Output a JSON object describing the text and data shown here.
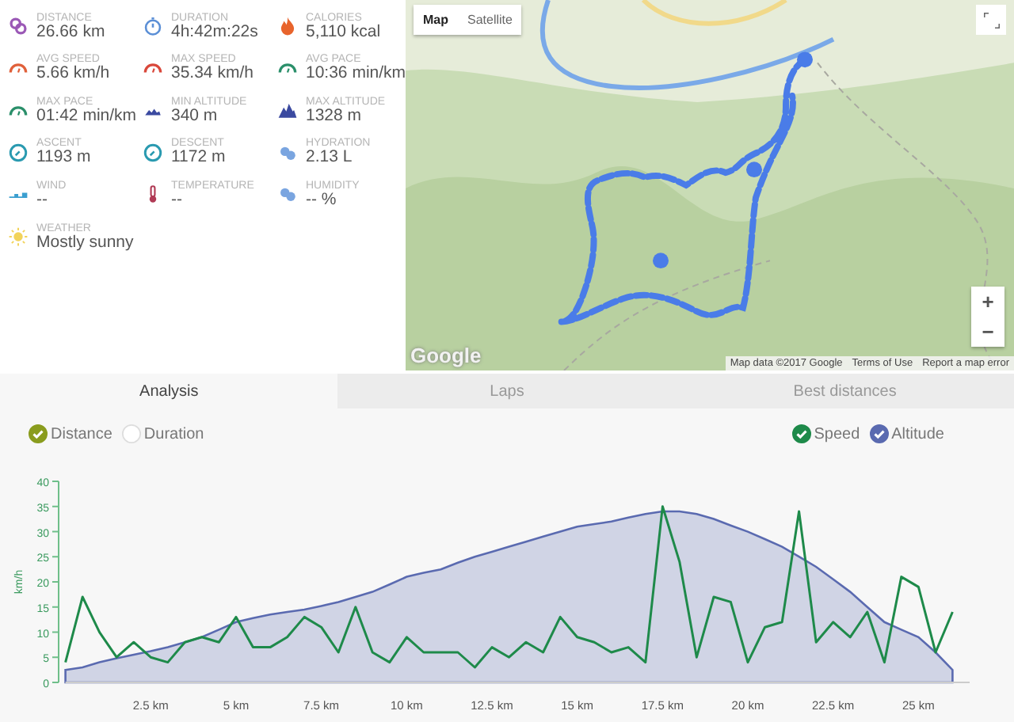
{
  "stats": [
    {
      "kind": "distance",
      "label": "DISTANCE",
      "value": "26.66 km"
    },
    {
      "kind": "duration",
      "label": "DURATION",
      "value": "4h:42m:22s"
    },
    {
      "kind": "calories",
      "label": "CALORIES",
      "value": "5,110 kcal"
    },
    {
      "kind": "avg-speed",
      "label": "AVG SPEED",
      "value": "5.66 km/h"
    },
    {
      "kind": "max-speed",
      "label": "MAX SPEED",
      "value": "35.34 km/h"
    },
    {
      "kind": "pace",
      "label": "AVG PACE",
      "value": "10:36 min/km"
    },
    {
      "kind": "pace",
      "label": "MAX PACE",
      "value": "01:42 min/km"
    },
    {
      "kind": "min-altitude",
      "label": "MIN ALTITUDE",
      "value": "340 m"
    },
    {
      "kind": "max-altitude",
      "label": "MAX ALTITUDE",
      "value": "1328 m"
    },
    {
      "kind": "ascent",
      "label": "ASCENT",
      "value": "1193 m"
    },
    {
      "kind": "descent",
      "label": "DESCENT",
      "value": "1172 m"
    },
    {
      "kind": "hydration",
      "label": "HYDRATION",
      "value": "2.13 L"
    },
    {
      "kind": "wind",
      "label": "WIND",
      "value": "--"
    },
    {
      "kind": "temperature",
      "label": "TEMPERATURE",
      "value": "--"
    },
    {
      "kind": "humidity",
      "label": "HUMIDITY",
      "value": "-- %"
    },
    {
      "kind": "weather",
      "label": "WEATHER",
      "value": "Mostly sunny"
    }
  ],
  "map": {
    "map_types": [
      {
        "label": "Map",
        "selected": true
      },
      {
        "label": "Satellite",
        "selected": false
      }
    ],
    "zoom_in": "+",
    "zoom_out": "−",
    "logo": "Google",
    "attribution": "Map data ©2017 Google",
    "links": [
      "Terms of Use",
      "Report a map error"
    ]
  },
  "tabs": [
    {
      "label": "Analysis",
      "selected": true
    },
    {
      "label": "Laps",
      "selected": false
    },
    {
      "label": "Best distances",
      "selected": false
    }
  ],
  "axis_toggles": [
    {
      "label": "Distance",
      "checked": true,
      "color": "#8a9c1e"
    },
    {
      "label": "Duration",
      "checked": false
    }
  ],
  "series_toggles": [
    {
      "checked": true,
      "color": "#1e8a4a"
    },
    {
      "checked": true,
      "color": "#5a6ab0"
    }
  ],
  "chart_data": {
    "type": "line",
    "ylabel": "km/h",
    "xlim": [
      0,
      26.5
    ],
    "ylim": [
      0,
      40
    ],
    "yticks": [
      0,
      5,
      10,
      15,
      20,
      25,
      30,
      35,
      40
    ],
    "xticks": [
      {
        "value": 2.5,
        "label": "2.5 km"
      },
      {
        "value": 5,
        "label": "5 km"
      },
      {
        "value": 7.5,
        "label": "7.5 km"
      },
      {
        "value": 10,
        "label": "10 km"
      },
      {
        "value": 12.5,
        "label": "12.5 km"
      },
      {
        "value": 15,
        "label": "15 km"
      },
      {
        "value": 17.5,
        "label": "17.5 km"
      },
      {
        "value": 20,
        "label": "20 km"
      },
      {
        "value": 22.5,
        "label": "22.5 km"
      },
      {
        "value": 25,
        "label": "25 km"
      }
    ],
    "x": [
      0,
      0.5,
      1,
      1.5,
      2,
      2.5,
      3,
      3.5,
      4,
      4.5,
      5,
      5.5,
      6,
      6.5,
      7,
      7.5,
      8,
      8.5,
      9,
      9.5,
      10,
      10.5,
      11,
      11.5,
      12,
      12.5,
      13,
      13.5,
      14,
      14.5,
      15,
      15.5,
      16,
      16.5,
      17,
      17.5,
      18,
      18.5,
      19,
      19.5,
      20,
      20.5,
      21,
      21.5,
      22,
      22.5,
      23,
      23.5,
      24,
      24.5,
      25,
      25.5,
      26
    ],
    "series": [
      {
        "name": "Altitude",
        "type": "area",
        "color": "#5a6ab0",
        "values": [
          2.5,
          3,
          4,
          4.8,
          5.5,
          6.2,
          7,
          8,
          9,
          10.5,
          12,
          12.8,
          13.5,
          14,
          14.5,
          15.2,
          16,
          17,
          18,
          19.5,
          21,
          21.8,
          22.5,
          23.8,
          25,
          26,
          27,
          28,
          29,
          30,
          31,
          31.5,
          32,
          32.8,
          33.5,
          34,
          34,
          33.5,
          32.5,
          31.2,
          30,
          28.5,
          27,
          25,
          23,
          20.5,
          18,
          15,
          12,
          10.5,
          9,
          6,
          2.5
        ]
      },
      {
        "name": "Speed",
        "type": "line",
        "color": "#1e8a4a",
        "values": [
          4,
          17,
          10,
          5,
          8,
          5,
          4,
          8,
          9,
          8,
          13,
          7,
          7,
          9,
          13,
          11,
          6,
          15,
          6,
          4,
          9,
          6,
          6,
          6,
          3,
          7,
          5,
          8,
          6,
          13,
          9,
          8,
          6,
          7,
          4,
          35,
          24,
          5,
          17,
          16,
          4,
          11,
          12,
          34,
          8,
          12,
          9,
          14,
          4,
          21,
          19,
          6,
          14
        ]
      }
    ]
  }
}
